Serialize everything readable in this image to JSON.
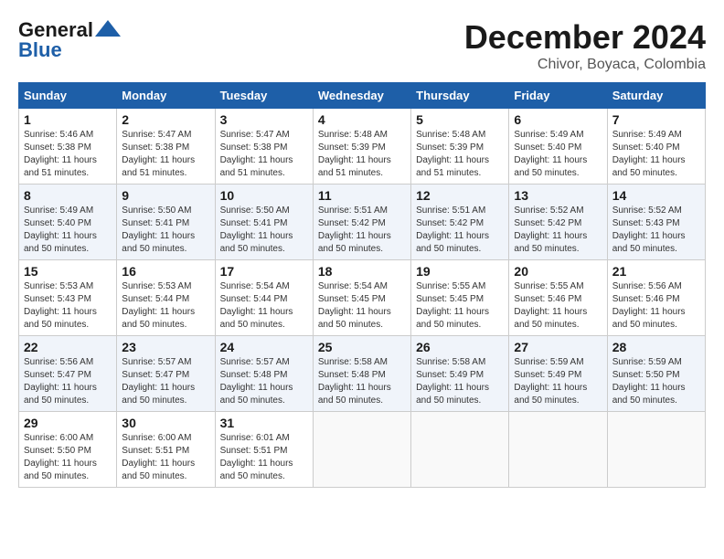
{
  "logo": {
    "line1": "General",
    "line2": "Blue"
  },
  "header": {
    "title": "December 2024",
    "subtitle": "Chivor, Boyaca, Colombia"
  },
  "days_of_week": [
    "Sunday",
    "Monday",
    "Tuesday",
    "Wednesday",
    "Thursday",
    "Friday",
    "Saturday"
  ],
  "weeks": [
    [
      {
        "day": "1",
        "info": "Sunrise: 5:46 AM\nSunset: 5:38 PM\nDaylight: 11 hours\nand 51 minutes."
      },
      {
        "day": "2",
        "info": "Sunrise: 5:47 AM\nSunset: 5:38 PM\nDaylight: 11 hours\nand 51 minutes."
      },
      {
        "day": "3",
        "info": "Sunrise: 5:47 AM\nSunset: 5:38 PM\nDaylight: 11 hours\nand 51 minutes."
      },
      {
        "day": "4",
        "info": "Sunrise: 5:48 AM\nSunset: 5:39 PM\nDaylight: 11 hours\nand 51 minutes."
      },
      {
        "day": "5",
        "info": "Sunrise: 5:48 AM\nSunset: 5:39 PM\nDaylight: 11 hours\nand 51 minutes."
      },
      {
        "day": "6",
        "info": "Sunrise: 5:49 AM\nSunset: 5:40 PM\nDaylight: 11 hours\nand 50 minutes."
      },
      {
        "day": "7",
        "info": "Sunrise: 5:49 AM\nSunset: 5:40 PM\nDaylight: 11 hours\nand 50 minutes."
      }
    ],
    [
      {
        "day": "8",
        "info": "Sunrise: 5:49 AM\nSunset: 5:40 PM\nDaylight: 11 hours\nand 50 minutes."
      },
      {
        "day": "9",
        "info": "Sunrise: 5:50 AM\nSunset: 5:41 PM\nDaylight: 11 hours\nand 50 minutes."
      },
      {
        "day": "10",
        "info": "Sunrise: 5:50 AM\nSunset: 5:41 PM\nDaylight: 11 hours\nand 50 minutes."
      },
      {
        "day": "11",
        "info": "Sunrise: 5:51 AM\nSunset: 5:42 PM\nDaylight: 11 hours\nand 50 minutes."
      },
      {
        "day": "12",
        "info": "Sunrise: 5:51 AM\nSunset: 5:42 PM\nDaylight: 11 hours\nand 50 minutes."
      },
      {
        "day": "13",
        "info": "Sunrise: 5:52 AM\nSunset: 5:42 PM\nDaylight: 11 hours\nand 50 minutes."
      },
      {
        "day": "14",
        "info": "Sunrise: 5:52 AM\nSunset: 5:43 PM\nDaylight: 11 hours\nand 50 minutes."
      }
    ],
    [
      {
        "day": "15",
        "info": "Sunrise: 5:53 AM\nSunset: 5:43 PM\nDaylight: 11 hours\nand 50 minutes."
      },
      {
        "day": "16",
        "info": "Sunrise: 5:53 AM\nSunset: 5:44 PM\nDaylight: 11 hours\nand 50 minutes."
      },
      {
        "day": "17",
        "info": "Sunrise: 5:54 AM\nSunset: 5:44 PM\nDaylight: 11 hours\nand 50 minutes."
      },
      {
        "day": "18",
        "info": "Sunrise: 5:54 AM\nSunset: 5:45 PM\nDaylight: 11 hours\nand 50 minutes."
      },
      {
        "day": "19",
        "info": "Sunrise: 5:55 AM\nSunset: 5:45 PM\nDaylight: 11 hours\nand 50 minutes."
      },
      {
        "day": "20",
        "info": "Sunrise: 5:55 AM\nSunset: 5:46 PM\nDaylight: 11 hours\nand 50 minutes."
      },
      {
        "day": "21",
        "info": "Sunrise: 5:56 AM\nSunset: 5:46 PM\nDaylight: 11 hours\nand 50 minutes."
      }
    ],
    [
      {
        "day": "22",
        "info": "Sunrise: 5:56 AM\nSunset: 5:47 PM\nDaylight: 11 hours\nand 50 minutes."
      },
      {
        "day": "23",
        "info": "Sunrise: 5:57 AM\nSunset: 5:47 PM\nDaylight: 11 hours\nand 50 minutes."
      },
      {
        "day": "24",
        "info": "Sunrise: 5:57 AM\nSunset: 5:48 PM\nDaylight: 11 hours\nand 50 minutes."
      },
      {
        "day": "25",
        "info": "Sunrise: 5:58 AM\nSunset: 5:48 PM\nDaylight: 11 hours\nand 50 minutes."
      },
      {
        "day": "26",
        "info": "Sunrise: 5:58 AM\nSunset: 5:49 PM\nDaylight: 11 hours\nand 50 minutes."
      },
      {
        "day": "27",
        "info": "Sunrise: 5:59 AM\nSunset: 5:49 PM\nDaylight: 11 hours\nand 50 minutes."
      },
      {
        "day": "28",
        "info": "Sunrise: 5:59 AM\nSunset: 5:50 PM\nDaylight: 11 hours\nand 50 minutes."
      }
    ],
    [
      {
        "day": "29",
        "info": "Sunrise: 6:00 AM\nSunset: 5:50 PM\nDaylight: 11 hours\nand 50 minutes."
      },
      {
        "day": "30",
        "info": "Sunrise: 6:00 AM\nSunset: 5:51 PM\nDaylight: 11 hours\nand 50 minutes."
      },
      {
        "day": "31",
        "info": "Sunrise: 6:01 AM\nSunset: 5:51 PM\nDaylight: 11 hours\nand 50 minutes."
      },
      {
        "day": "",
        "info": ""
      },
      {
        "day": "",
        "info": ""
      },
      {
        "day": "",
        "info": ""
      },
      {
        "day": "",
        "info": ""
      }
    ]
  ]
}
